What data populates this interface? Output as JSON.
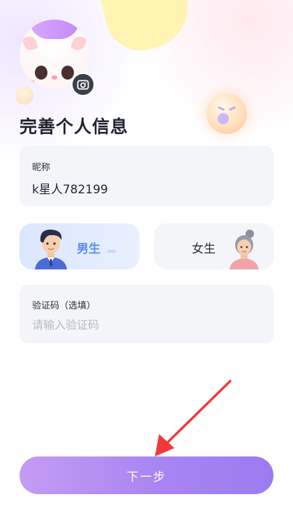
{
  "page": {
    "title": "完善个人信息"
  },
  "nickname": {
    "label": "昵称",
    "value": "k星人782199"
  },
  "gender": {
    "male_label": "男生",
    "female_label": "女生",
    "selected": "男生"
  },
  "verification": {
    "label": "验证码（选填）",
    "placeholder": "请输入验证码"
  },
  "actions": {
    "next_label": "下一步"
  },
  "colors": {
    "accent_male": "#5b8def",
    "button_start": "#c59bf4",
    "button_end": "#9b7bf0",
    "annotation_arrow": "#f03a3a"
  }
}
